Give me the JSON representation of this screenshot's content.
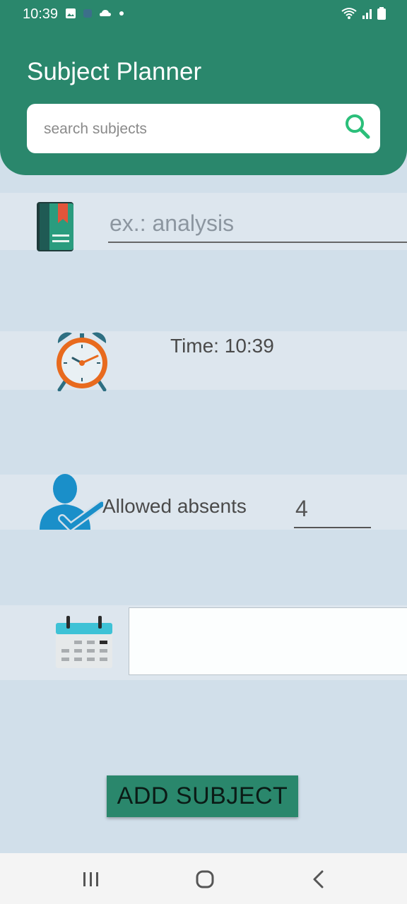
{
  "status_bar": {
    "time": "10:39",
    "left_icons": [
      "image-icon",
      "app-icon",
      "cloud-icon",
      "dot-icon"
    ],
    "right_icons": [
      "wifi-icon",
      "signal-icon",
      "battery-icon"
    ]
  },
  "header": {
    "title": "Subject Planner",
    "search_placeholder": "search subjects",
    "search_value": ""
  },
  "form": {
    "subject_placeholder": "ex.: analysis",
    "subject_value": "",
    "time_label": "Time: 10:39",
    "absents_label": "Allowed absents",
    "absents_value": "4",
    "date_value": ""
  },
  "actions": {
    "add_label": "ADD SUBJECT"
  },
  "colors": {
    "primary": "#2a876c",
    "background": "#d1dfea",
    "band": "#dde6ee"
  },
  "nav_bar": {
    "items": [
      "recents-button",
      "home-button",
      "back-button"
    ]
  }
}
